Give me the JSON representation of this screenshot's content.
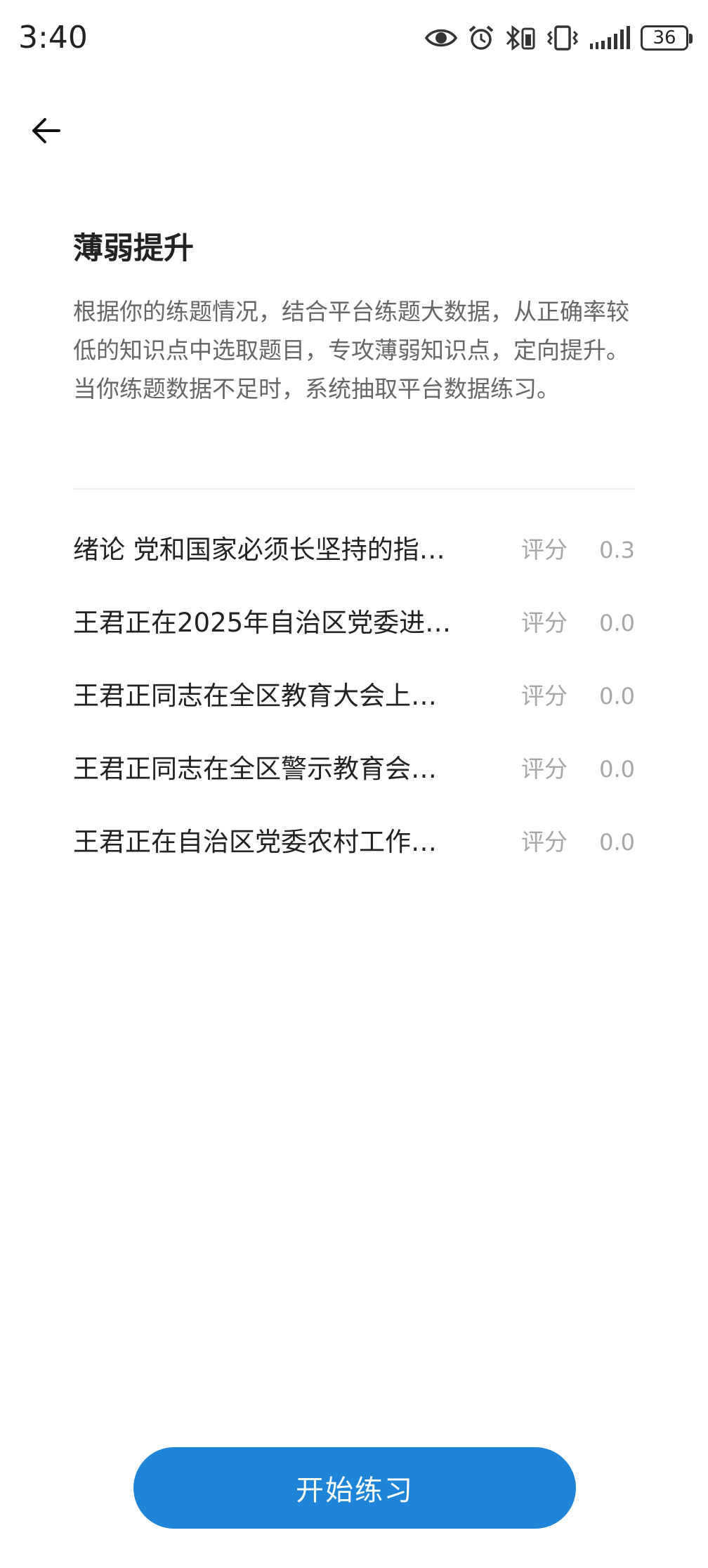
{
  "status_bar": {
    "time": "3:40",
    "battery": "36",
    "icons": [
      "eye-icon",
      "alarm-icon",
      "bluetooth-icon",
      "vibrate-icon",
      "signal-icon",
      "battery-icon"
    ]
  },
  "header": {
    "back_icon": "arrow-left-icon"
  },
  "intro": {
    "title": "薄弱提升",
    "description_1": "根据你的练题情况，结合平台练题大数据，从正确率较低的知识点中选取题目，专攻薄弱知识点，定向提升。",
    "description_2": "当你练题数据不足时，系统抽取平台数据练习。"
  },
  "topics": [
    {
      "title": "绪论 党和国家必须长坚持的指…",
      "score_label": "评分",
      "score": "0.3"
    },
    {
      "title": "王君正在2025年自治区党委进…",
      "score_label": "评分",
      "score": "0.0"
    },
    {
      "title": "王君正同志在全区教育大会上…",
      "score_label": "评分",
      "score": "0.0"
    },
    {
      "title": "王君正同志在全区警示教育会…",
      "score_label": "评分",
      "score": "0.0"
    },
    {
      "title": "王君正在自治区党委农村工作…",
      "score_label": "评分",
      "score": "0.0"
    }
  ],
  "footer": {
    "start_label": "开始练习"
  },
  "colors": {
    "accent": "#1e84d8",
    "text": "#222222",
    "secondary": "#666666",
    "muted": "#a6a6a6"
  }
}
